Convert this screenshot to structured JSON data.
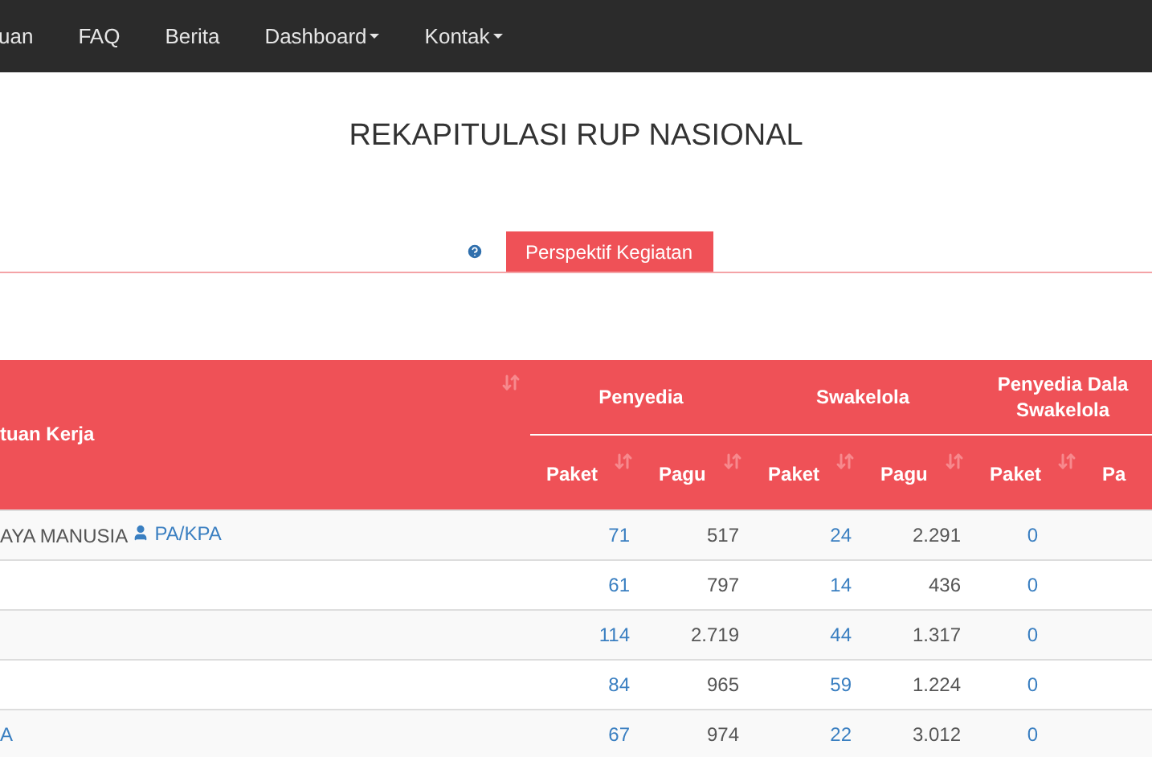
{
  "navbar": {
    "items": [
      {
        "label": "uan",
        "dropdown": false
      },
      {
        "label": "FAQ",
        "dropdown": false
      },
      {
        "label": "Berita",
        "dropdown": false
      },
      {
        "label": "Dashboard",
        "dropdown": true
      },
      {
        "label": "Kontak",
        "dropdown": true
      }
    ]
  },
  "page_title": "REKAPITULASI RUP NASIONAL",
  "tabs": [
    {
      "label": "Perspektif Kegiatan",
      "selected": true
    }
  ],
  "table": {
    "name_header": {
      "label": "tuan Kerja",
      "sortable": true
    },
    "groups": [
      {
        "lines": [
          "Penyedia"
        ]
      },
      {
        "lines": [
          "Swakelola"
        ]
      },
      {
        "lines": [
          "Penyedia Dala",
          "Swakelola"
        ]
      }
    ],
    "sub_columns": [
      {
        "label": "Paket",
        "sortable": true
      },
      {
        "label": "Pagu",
        "sortable": true
      },
      {
        "label": "Paket",
        "sortable": true
      },
      {
        "label": "Pagu",
        "sortable": true
      },
      {
        "label": "Paket",
        "sortable": true
      },
      {
        "label": "Pa",
        "sortable": false
      }
    ],
    "rows": [
      {
        "name": "AYA MANUSIA",
        "role_link": "PA/KPA",
        "cells": [
          "71",
          "517",
          "24",
          "2.291",
          "0"
        ]
      },
      {
        "cells": [
          "61",
          "797",
          "14",
          "436",
          "0"
        ]
      },
      {
        "cells": [
          "114",
          "2.719",
          "44",
          "1.317",
          "0"
        ]
      },
      {
        "cells": [
          "84",
          "965",
          "59",
          "1.224",
          "0"
        ]
      },
      {
        "name_link": "A",
        "cells": [
          "67",
          "974",
          "22",
          "3.012",
          "0"
        ]
      }
    ]
  }
}
